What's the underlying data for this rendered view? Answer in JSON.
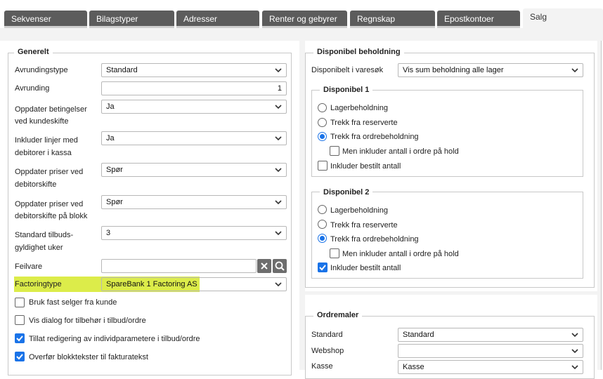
{
  "tabs": [
    {
      "label": "Sekvenser"
    },
    {
      "label": "Bilagstyper"
    },
    {
      "label": "Adresser"
    },
    {
      "label": "Renter og gebyrer"
    },
    {
      "label": "Regnskap"
    },
    {
      "label": "Epostkontoer"
    },
    {
      "label": "Salg"
    }
  ],
  "generelt": {
    "legend": "Generelt",
    "avrundingstype": {
      "label": "Avrundingstype",
      "value": "Standard"
    },
    "avrunding": {
      "label": "Avrunding",
      "value": "1"
    },
    "oppdater_betingelser": {
      "label1": "Oppdater betingelser",
      "label2": "ved kundeskifte",
      "value": "Ja"
    },
    "inkluder_linjer": {
      "label1": "Inkluder linjer med",
      "label2": "debitorer i kassa",
      "value": "Ja"
    },
    "oppdater_priser": {
      "label1": "Oppdater priser ved",
      "label2": "debitorskifte",
      "value": "Spør"
    },
    "oppdater_priser_blokk": {
      "label1": "Oppdater priser ved",
      "label2": "debitorskifte på blokk",
      "value": "Spør"
    },
    "standard_tilbud": {
      "label1": "Standard tilbuds-",
      "label2": "gyldighet uker",
      "value": "3"
    },
    "feilvare": {
      "label": "Feilvare",
      "value": ""
    },
    "factoringtype": {
      "label": "Factoringtype",
      "value": "SpareBank 1 Factoring AS"
    },
    "checkboxes": [
      {
        "label": "Bruk fast selger fra kunde",
        "checked": false
      },
      {
        "label": "Vis dialog for tilbehør i tilbud/ordre",
        "checked": false
      },
      {
        "label": "Tillat redigering av individparametere i tilbud/ordre",
        "checked": true
      },
      {
        "label": "Overfør blokktekster til fakturatekst",
        "checked": true
      }
    ]
  },
  "beholdning": {
    "legend": "Disponibel beholdning",
    "varesok": {
      "label": "Disponibelt i varesøk",
      "value": "Vis sum beholdning alle lager"
    },
    "disp1": {
      "legend": "Disponibel 1",
      "radios": [
        "Lagerbeholdning",
        "Trekk fra reserverte",
        "Trekk fra ordrebeholdning"
      ],
      "selected": 2,
      "sub": {
        "label": "Men inkluder antall i ordre på hold",
        "checked": false
      },
      "bestilt": {
        "label": "Inkluder bestilt antall",
        "checked": false
      }
    },
    "disp2": {
      "legend": "Disponibel 2",
      "radios": [
        "Lagerbeholdning",
        "Trekk fra reserverte",
        "Trekk fra ordrebeholdning"
      ],
      "selected": 2,
      "sub": {
        "label": "Men inkluder antall i ordre på hold",
        "checked": false
      },
      "bestilt": {
        "label": "Inkluder bestilt antall",
        "checked": true
      }
    }
  },
  "ordremaler": {
    "legend": "Ordremaler",
    "standard": {
      "label": "Standard",
      "value": "Standard"
    },
    "webshop": {
      "label": "Webshop",
      "value": ""
    },
    "kasse": {
      "label": "Kasse",
      "value": "Kasse"
    }
  },
  "colors": {
    "accent": "#1a73e8",
    "highlight": "#dcec4a",
    "tab_bg": "#5c5c5c"
  }
}
